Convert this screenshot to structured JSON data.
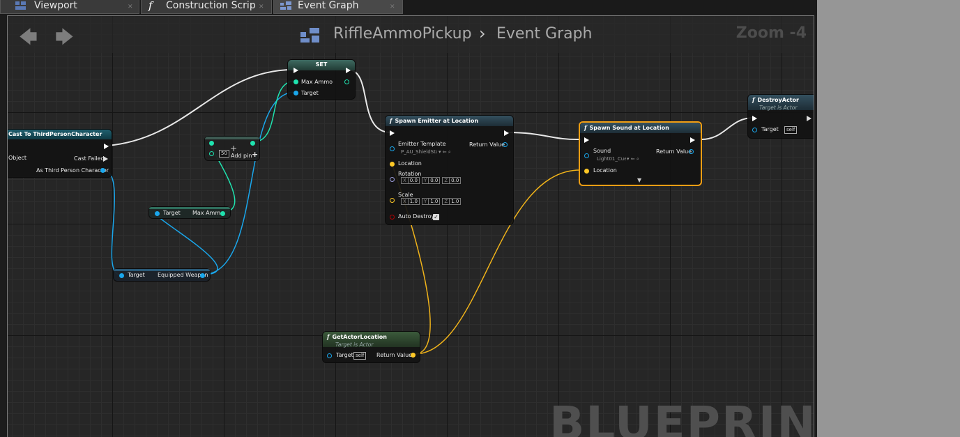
{
  "tabs": [
    {
      "label": "Viewport",
      "icon": "viewport-icon"
    },
    {
      "label": "Construction Scrip",
      "icon": "function-icon"
    },
    {
      "label": "Event Graph",
      "icon": "event-graph-icon",
      "active": true
    }
  ],
  "header": {
    "blueprint_name": "RiffleAmmoPickup",
    "separator": "›",
    "graph_name": "Event Graph",
    "zoom": "Zoom -4"
  },
  "watermark": "BLUEPRINT",
  "nodes": {
    "cast": {
      "title": "Cast To ThirdPersonCharacter",
      "object": "Object",
      "cast_failed": "Cast Failed",
      "as_char": "As Third Person Character"
    },
    "set": {
      "title": "SET",
      "max_ammo": "Max Ammo",
      "target": "Target"
    },
    "add": {
      "value": "50",
      "add_pin": "Add pin"
    },
    "get_max_ammo": {
      "target": "Target",
      "output": "Max Ammo"
    },
    "get_weapon": {
      "target": "Target",
      "output": "Equipped Weapon"
    },
    "spawn_emitter": {
      "title": "Spawn Emitter at Location",
      "emitter_template": "Emitter Template",
      "template_value": "P_AU_ShieldStart",
      "return_value": "Return Value",
      "location": "Location",
      "rotation": "Rotation",
      "scale": "Scale",
      "auto_destroy": "Auto Destroy",
      "rotation_xyz": [
        {
          "k": "X",
          "v": "0.0"
        },
        {
          "k": "Y",
          "v": "0.0"
        },
        {
          "k": "Z",
          "v": "0.0"
        }
      ],
      "scale_xyz": [
        {
          "k": "X",
          "v": "1.0"
        },
        {
          "k": "Y",
          "v": "1.0"
        },
        {
          "k": "Z",
          "v": "1.0"
        }
      ]
    },
    "spawn_sound": {
      "title": "Spawn Sound at Location",
      "sound": "Sound",
      "sound_value": "Light01_Cue",
      "return_value": "Return Value",
      "location": "Location"
    },
    "destroy": {
      "title": "DestroyActor",
      "subtitle": "Target is Actor",
      "target": "Target",
      "self": "self"
    },
    "get_loc": {
      "title": "GetActorLocation",
      "subtitle": "Target is Actor",
      "target": "Target",
      "self": "self",
      "return_value": "Return Value"
    }
  },
  "colors": {
    "exec": "#ffffff",
    "object": "#1aa7ec",
    "integer": "#1fe3af",
    "vector": "#fdc826",
    "struct": "#1aa7ec",
    "bool": "#940000",
    "selected": "#f19e13"
  }
}
